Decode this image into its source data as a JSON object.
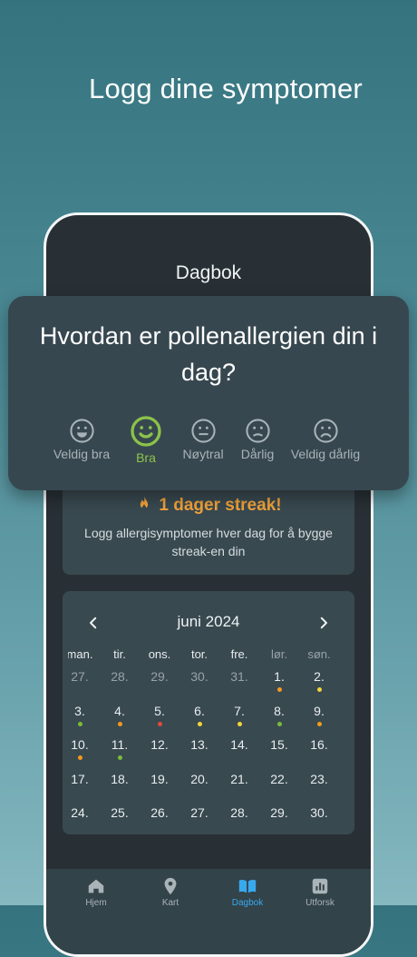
{
  "headline": "Logg dine symptomer",
  "screen_title": "Dagbok",
  "mood_prompt": {
    "question": "Hvordan er pollenallergien din i dag?",
    "options": [
      {
        "label": "Veldig bra",
        "icon": "very-happy-face-icon"
      },
      {
        "label": "Bra",
        "icon": "happy-face-icon"
      },
      {
        "label": "Nøytral",
        "icon": "neutral-face-icon"
      },
      {
        "label": "Dårlig",
        "icon": "sad-face-icon"
      },
      {
        "label": "Veldig dårlig",
        "icon": "very-sad-face-icon"
      }
    ],
    "selected": "Bra"
  },
  "streak": {
    "title": "1 dager streak!",
    "description": "Logg allergisymptomer hver dag for å bygge streak-en din"
  },
  "calendar": {
    "month": "juni 2024",
    "weekdays": [
      "man.",
      "tir.",
      "ons.",
      "tor.",
      "fre.",
      "lør.",
      "søn."
    ],
    "rows": [
      [
        {
          "d": "27.",
          "out": true
        },
        {
          "d": "28.",
          "out": true
        },
        {
          "d": "29.",
          "out": true
        },
        {
          "d": "30.",
          "out": true
        },
        {
          "d": "31.",
          "out": true
        },
        {
          "d": "1.",
          "dot": "orange"
        },
        {
          "d": "2.",
          "dot": "yellow"
        }
      ],
      [
        {
          "d": "3.",
          "dot": "green"
        },
        {
          "d": "4.",
          "dot": "orange"
        },
        {
          "d": "5.",
          "dot": "red"
        },
        {
          "d": "6.",
          "dot": "yellow"
        },
        {
          "d": "7.",
          "dot": "yellow"
        },
        {
          "d": "8.",
          "dot": "green"
        },
        {
          "d": "9.",
          "dot": "orange"
        }
      ],
      [
        {
          "d": "10.",
          "dot": "orange"
        },
        {
          "d": "11.",
          "dot": "green"
        },
        {
          "d": "12."
        },
        {
          "d": "13."
        },
        {
          "d": "14."
        },
        {
          "d": "15."
        },
        {
          "d": "16."
        }
      ],
      [
        {
          "d": "17."
        },
        {
          "d": "18."
        },
        {
          "d": "19."
        },
        {
          "d": "20."
        },
        {
          "d": "21."
        },
        {
          "d": "22."
        },
        {
          "d": "23."
        }
      ],
      [
        {
          "d": "24."
        },
        {
          "d": "25."
        },
        {
          "d": "26."
        },
        {
          "d": "27."
        },
        {
          "d": "28."
        },
        {
          "d": "29."
        },
        {
          "d": "30."
        }
      ]
    ]
  },
  "tabs": [
    {
      "label": "Hjem",
      "icon": "home-icon"
    },
    {
      "label": "Kart",
      "icon": "map-pin-icon"
    },
    {
      "label": "Dagbok",
      "icon": "book-icon",
      "active": true
    },
    {
      "label": "Utforsk",
      "icon": "chart-icon"
    }
  ],
  "colors": {
    "accent": "#39a9ee",
    "selected_mood": "#8bc34a",
    "streak": "#f0a23a",
    "dot_green": "#7cbb3a",
    "dot_yellow": "#f3d43a",
    "dot_orange": "#f39a1e",
    "dot_red": "#e5483b"
  }
}
